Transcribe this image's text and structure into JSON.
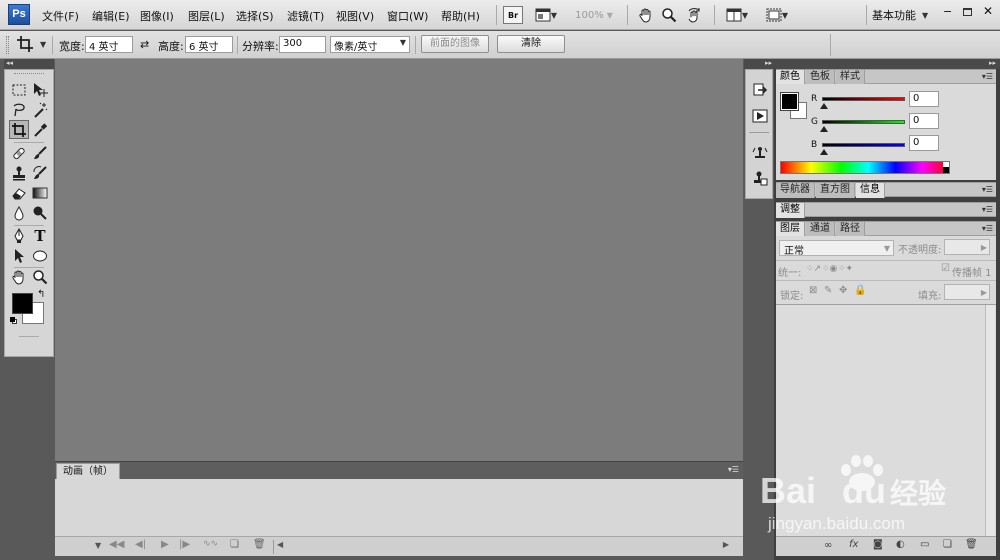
{
  "menubar": {
    "logo": "Ps",
    "items": [
      "文件(F)",
      "编辑(E)",
      "图像(I)",
      "图层(L)",
      "选择(S)",
      "滤镜(T)",
      "视图(V)",
      "窗口(W)",
      "帮助(H)"
    ],
    "bridge_label": "Br",
    "zoom": "100%",
    "workspace": "基本功能"
  },
  "options": {
    "width_label": "宽度:",
    "width_value": "4 英寸",
    "height_label": "高度:",
    "height_value": "6 英寸",
    "resolution_label": "分辨率:",
    "resolution_value": "300",
    "unit_value": "像素/英寸",
    "front_image_label": "前面的图像",
    "clear_label": "清除"
  },
  "animation": {
    "tab": "动画（帧）"
  },
  "color_panel": {
    "tabs": [
      "颜色",
      "色板",
      "样式"
    ],
    "r_label": "R",
    "g_label": "G",
    "b_label": "B",
    "r_value": "0",
    "g_value": "0",
    "b_value": "0"
  },
  "navigator_panel": {
    "tabs": [
      "导航器",
      "直方图",
      "信息"
    ]
  },
  "adjust_panel": {
    "tab": "调整"
  },
  "layers_panel": {
    "tabs": [
      "图层",
      "通道",
      "路径"
    ],
    "blend_mode": "正常",
    "opacity_label": "不透明度:",
    "unify_label": "统一:",
    "propagate_label": "传播帧 1",
    "lock_label": "锁定:",
    "fill_label": "填充:"
  },
  "watermark": {
    "brand_a": "Bai",
    "brand_b": "du",
    "brand_cn": "经验",
    "url": "jingyan.baidu.com"
  },
  "colors": {
    "foreground": "#000000",
    "background": "#ffffff",
    "canvas": "#7c7c7c"
  }
}
